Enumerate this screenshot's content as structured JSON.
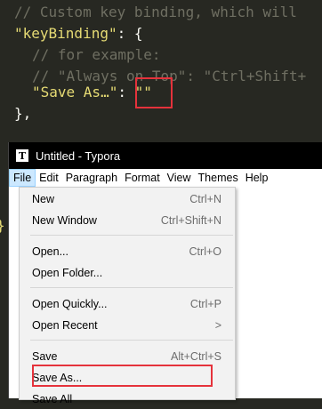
{
  "editor": {
    "line1": "// Custom key binding, which will",
    "line2_key": "\"keyBinding\"",
    "line2_rest": ": {",
    "line3": "// for example:",
    "line4": "// \"Always on Top\": \"Ctrl+Shift+",
    "line5_key": "\"Save As…\"",
    "line5_sep": ": ",
    "line5_value": "\"\"",
    "line6": "},",
    "left_brace": "}"
  },
  "window": {
    "title": "Untitled - Typora",
    "icon_letter": "T"
  },
  "menubar": {
    "items": [
      "File",
      "Edit",
      "Paragraph",
      "Format",
      "View",
      "Themes",
      "Help"
    ]
  },
  "file_menu": {
    "items": [
      {
        "label": "New",
        "shortcut": "Ctrl+N"
      },
      {
        "label": "New Window",
        "shortcut": "Ctrl+Shift+N"
      },
      {
        "label": "Open...",
        "shortcut": "Ctrl+O"
      },
      {
        "label": "Open Folder...",
        "shortcut": ""
      },
      {
        "label": "Open Quickly...",
        "shortcut": "Ctrl+P"
      },
      {
        "label": "Open Recent",
        "shortcut": ">"
      },
      {
        "label": "Save",
        "shortcut": "Alt+Ctrl+S"
      },
      {
        "label": "Save As...",
        "shortcut": ""
      },
      {
        "label": "Save All",
        "shortcut": ""
      }
    ]
  },
  "colors": {
    "highlight_box": "#e5323b",
    "editor_bg": "#272822",
    "string": "#e6db74",
    "comment": "#6f6f62"
  }
}
